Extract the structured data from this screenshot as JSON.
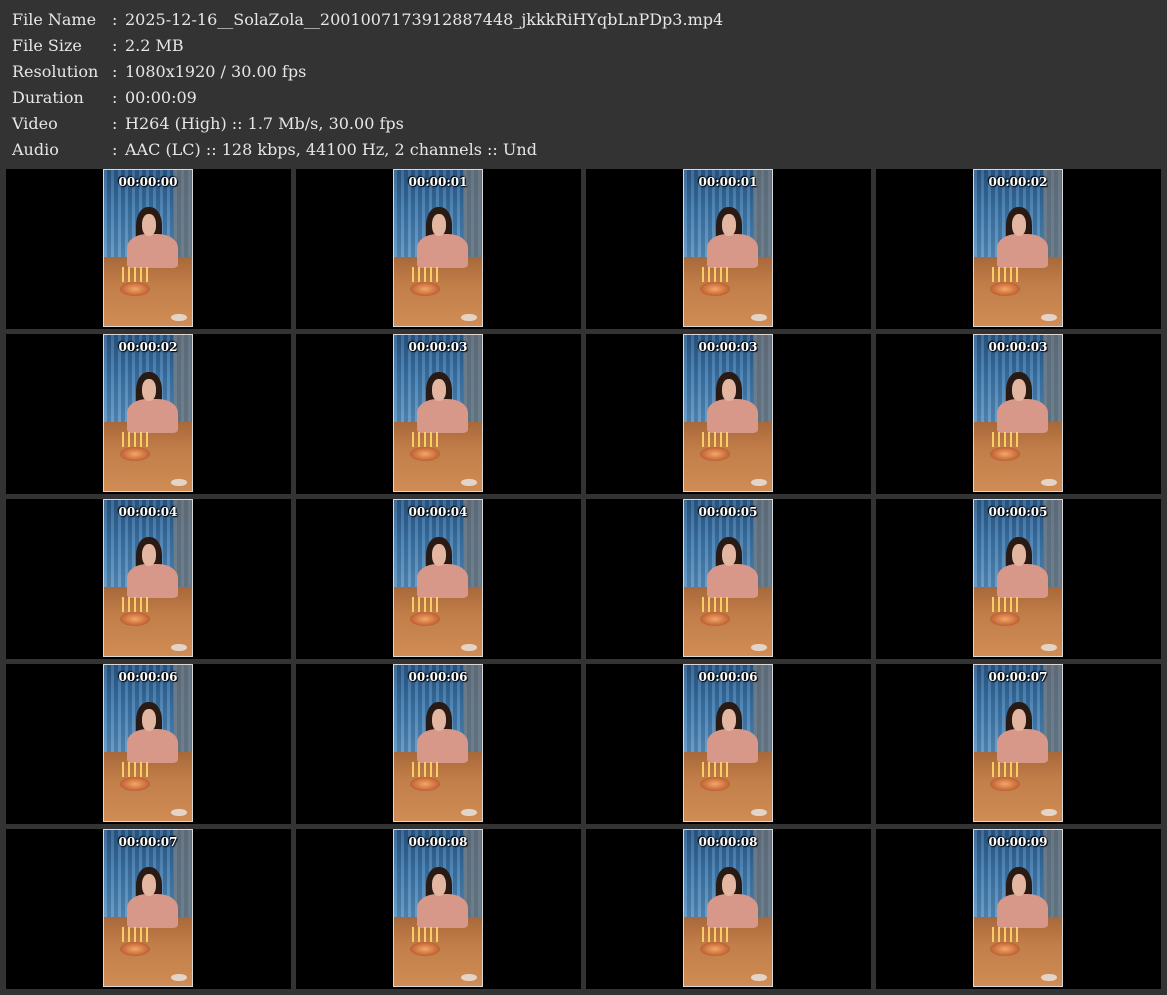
{
  "info": [
    {
      "label": "File Name",
      "sep": ":",
      "value": "2025-12-16__SolaZola__2001007173912887448_jkkkRiHYqbLnPDp3.mp4"
    },
    {
      "label": "File Size",
      "sep": ":",
      "value": "2.2 MB"
    },
    {
      "label": "Resolution",
      "sep": ":",
      "value": "1080x1920 / 30.00 fps"
    },
    {
      "label": "Duration",
      "sep": ":",
      "value": "00:00:09"
    },
    {
      "label": "Video",
      "sep": ":",
      "value": "H264 (High) :: 1.7 Mb/s, 30.00 fps"
    },
    {
      "label": "Audio",
      "sep": ":",
      "value": "AAC (LC) :: 128 kbps, 44100 Hz, 2 channels :: Und"
    }
  ],
  "thumbnails": [
    {
      "timestamp": "00:00:00"
    },
    {
      "timestamp": "00:00:01"
    },
    {
      "timestamp": "00:00:01"
    },
    {
      "timestamp": "00:00:02"
    },
    {
      "timestamp": "00:00:02"
    },
    {
      "timestamp": "00:00:03"
    },
    {
      "timestamp": "00:00:03"
    },
    {
      "timestamp": "00:00:03"
    },
    {
      "timestamp": "00:00:04"
    },
    {
      "timestamp": "00:00:04"
    },
    {
      "timestamp": "00:00:05"
    },
    {
      "timestamp": "00:00:05"
    },
    {
      "timestamp": "00:00:06"
    },
    {
      "timestamp": "00:00:06"
    },
    {
      "timestamp": "00:00:06"
    },
    {
      "timestamp": "00:00:07"
    },
    {
      "timestamp": "00:00:07"
    },
    {
      "timestamp": "00:00:08"
    },
    {
      "timestamp": "00:00:08"
    },
    {
      "timestamp": "00:00:09"
    }
  ],
  "colors": {
    "background": "#333333",
    "cell_background": "#000000",
    "text": "#e6e6e6",
    "timestamp_text": "#ffffff"
  }
}
